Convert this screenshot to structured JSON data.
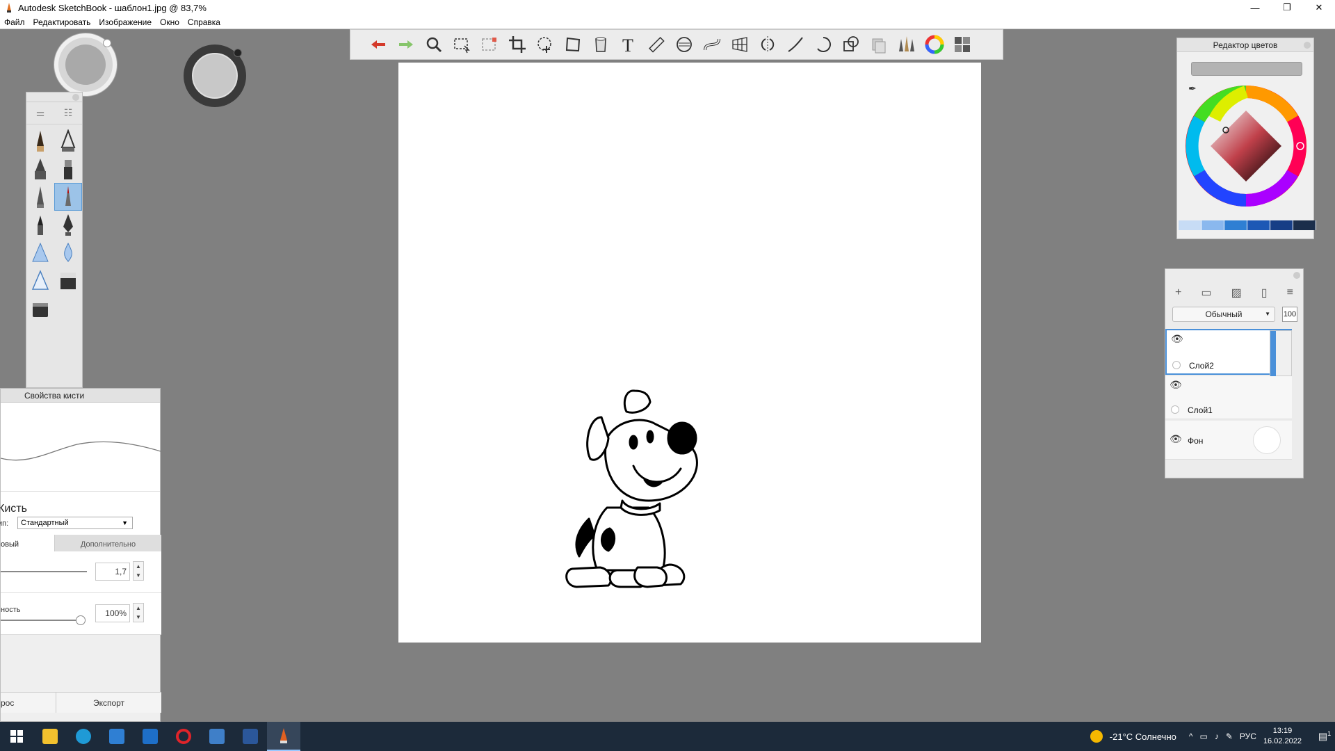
{
  "window": {
    "title": "Autodesk SketchBook - шаблон1.jpg @ 83,7%",
    "controls": [
      "—",
      "❐",
      "✕"
    ]
  },
  "menu": [
    "Файл",
    "Редактировать",
    "Изображение",
    "Окно",
    "Справка"
  ],
  "toolbar": {
    "tools": [
      "undo-icon",
      "redo-icon",
      "zoom-icon",
      "select-icon",
      "transform-select-icon",
      "crop-icon",
      "lasso-icon",
      "distort-icon",
      "fill-icon",
      "text-icon",
      "ruler-icon",
      "ellipse-guide-icon",
      "curve-icon",
      "perspective-icon",
      "symmetry-icon",
      "line-icon",
      "circle-icon",
      "shapes-icon",
      "copy-icon",
      "brushes-icon",
      "color-wheel-icon",
      "panels-icon"
    ],
    "text_tool_label": "T"
  },
  "brush_palette": {
    "tabs": [
      "sliders-icon",
      "library-icon"
    ],
    "brushes": [
      "pencil-icon",
      "airbrush-icon",
      "marker-icon",
      "chisel-marker-icon",
      "pen-icon",
      "ballpoint-icon",
      "brush-icon",
      "ink-pen-icon",
      "smudge-icon",
      "blur-icon",
      "triangle-icon",
      "eraser-icon",
      "hard-eraser-icon"
    ],
    "active_index": 5
  },
  "brush_properties": {
    "title": "Свойства кисти",
    "brush_label": "Кисть",
    "type_label": "ип:",
    "type_value": "Стандартный",
    "tab_basic": "овый",
    "tab_advanced": "Дополнительно",
    "size_value": "1,7",
    "opacity_label": "ность",
    "opacity_value": "100%",
    "reset_label": "рос",
    "export_label": "Экспорт"
  },
  "color_editor": {
    "title": "Редактор цветов",
    "current_color": "#b3b3b3",
    "swatches": [
      "#c7dcf5",
      "#8ab8ee",
      "#2f7fd3",
      "#1d58b5",
      "#173e86",
      "#1b2e4b"
    ]
  },
  "layers": {
    "blend_mode": "Обычный",
    "opacity": "100",
    "items": [
      {
        "name": "Слой2",
        "selected": true
      },
      {
        "name": "Слой1",
        "selected": false
      },
      {
        "name": "Фон",
        "selected": false
      }
    ]
  },
  "taskbar": {
    "apps": [
      "start-icon",
      "explorer-icon",
      "edge-icon",
      "store-icon",
      "mail-icon",
      "opera-icon",
      "photos-icon",
      "word-icon",
      "sketchbook-icon"
    ],
    "weather_temp": "-21°C",
    "weather_text": "Солнечно",
    "lang": "РУС",
    "time": "13:19",
    "date": "16.02.2022",
    "notification_count": "1"
  }
}
